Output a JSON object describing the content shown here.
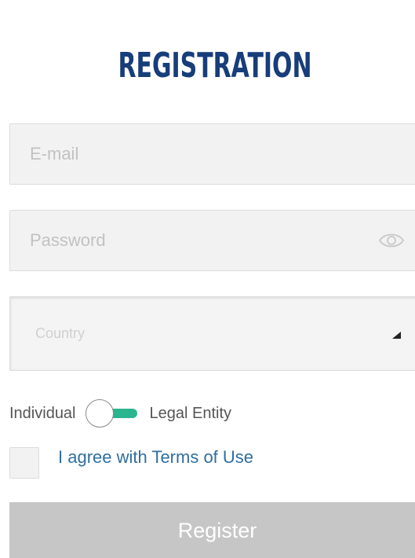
{
  "form": {
    "title": "REGISTRATION",
    "email": {
      "placeholder": "E-mail",
      "value": ""
    },
    "password": {
      "placeholder": "Password",
      "value": "",
      "icon": "eye-icon"
    },
    "country": {
      "placeholder": "Country",
      "icon": "caret-down-icon"
    },
    "entity_toggle": {
      "left_label": "Individual",
      "right_label": "Legal Entity",
      "track_color": "#2bb58f"
    },
    "terms": {
      "label": "I agree with Terms of Use",
      "checked": false
    },
    "submit_label": "Register"
  },
  "colors": {
    "title": "#173d7a",
    "link": "#2f6f9f",
    "button_disabled": "#c6c6c6"
  }
}
